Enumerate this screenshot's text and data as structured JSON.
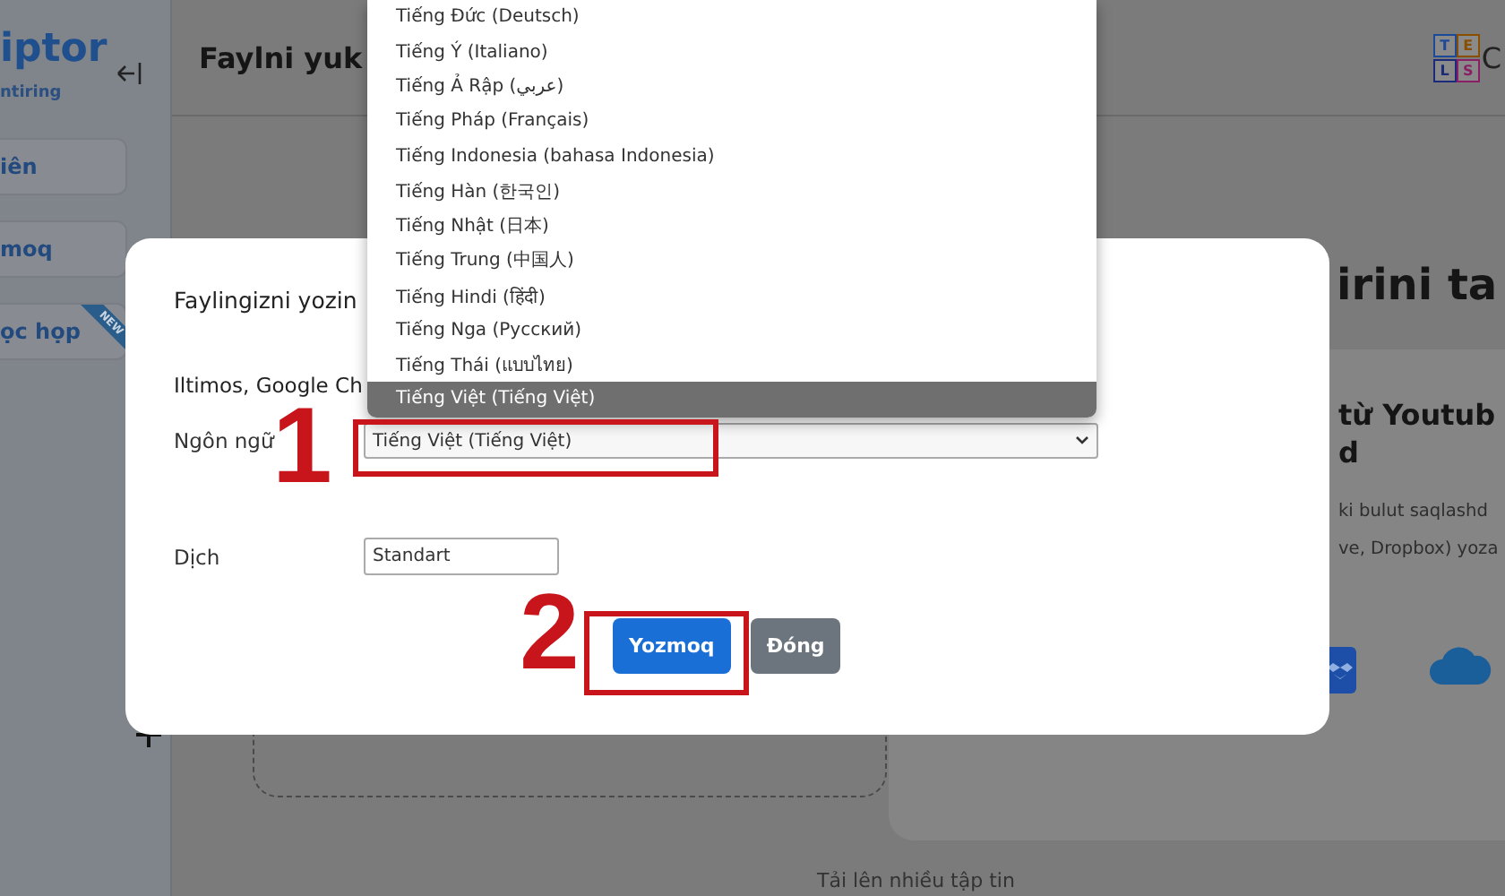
{
  "sidebar": {
    "logo": "iptor",
    "tagline": "ntiring",
    "items": [
      {
        "label": "iên"
      },
      {
        "label": "moq"
      },
      {
        "label": "ọc họp",
        "badge": "NEW"
      }
    ]
  },
  "header": {
    "title": "Faylni yuk",
    "logo_letters": [
      "T",
      "E",
      "L",
      "S"
    ],
    "logo_text": "C"
  },
  "content": {
    "heading": "irini ta",
    "card": {
      "title_lines": [
        "từ Youtub",
        "d"
      ],
      "text_lines": [
        "ki bulut saqlashd",
        "ve, Dropbox) yoza"
      ]
    },
    "upload_caption": "Tải lên nhiều tập tin"
  },
  "dialog": {
    "title": "Faylingizni yozin",
    "notice": "Iltimos, Google Ch",
    "fields": [
      {
        "kind": "select",
        "label": "Ngôn ngữ",
        "value": "Tiếng Việt (Tiếng Việt)"
      },
      {
        "kind": "input",
        "label": "Dịch",
        "value": "Standart"
      }
    ],
    "buttons": [
      {
        "kind": "primary",
        "label": "Yozmoq"
      },
      {
        "kind": "secondary",
        "label": "Đóng"
      }
    ]
  },
  "dropdown": {
    "options": [
      {
        "label": "Tiếng Đức (Deutsch)",
        "selected": false
      },
      {
        "label": "Tiếng Ý (Italiano)",
        "selected": false
      },
      {
        "label": "Tiếng Ả Rập (عربي)",
        "selected": false
      },
      {
        "label": "Tiếng Pháp (Français)",
        "selected": false
      },
      {
        "label": "Tiếng Indonesia (bahasa Indonesia)",
        "selected": false
      },
      {
        "label": "Tiếng Hàn (한국인)",
        "selected": false
      },
      {
        "label": "Tiếng Nhật (日本)",
        "selected": false
      },
      {
        "label": "Tiếng Trung (中国人)",
        "selected": false
      },
      {
        "label": "Tiếng Hindi (हिंदी)",
        "selected": false
      },
      {
        "label": "Tiếng Nga (Русский)",
        "selected": false
      },
      {
        "label": "Tiếng Thái (แบบไทย)",
        "selected": false
      },
      {
        "label": "Tiếng Việt (Tiếng Việt)",
        "selected": true
      }
    ]
  },
  "annotations": [
    {
      "number": "1"
    },
    {
      "number": "2"
    }
  ]
}
